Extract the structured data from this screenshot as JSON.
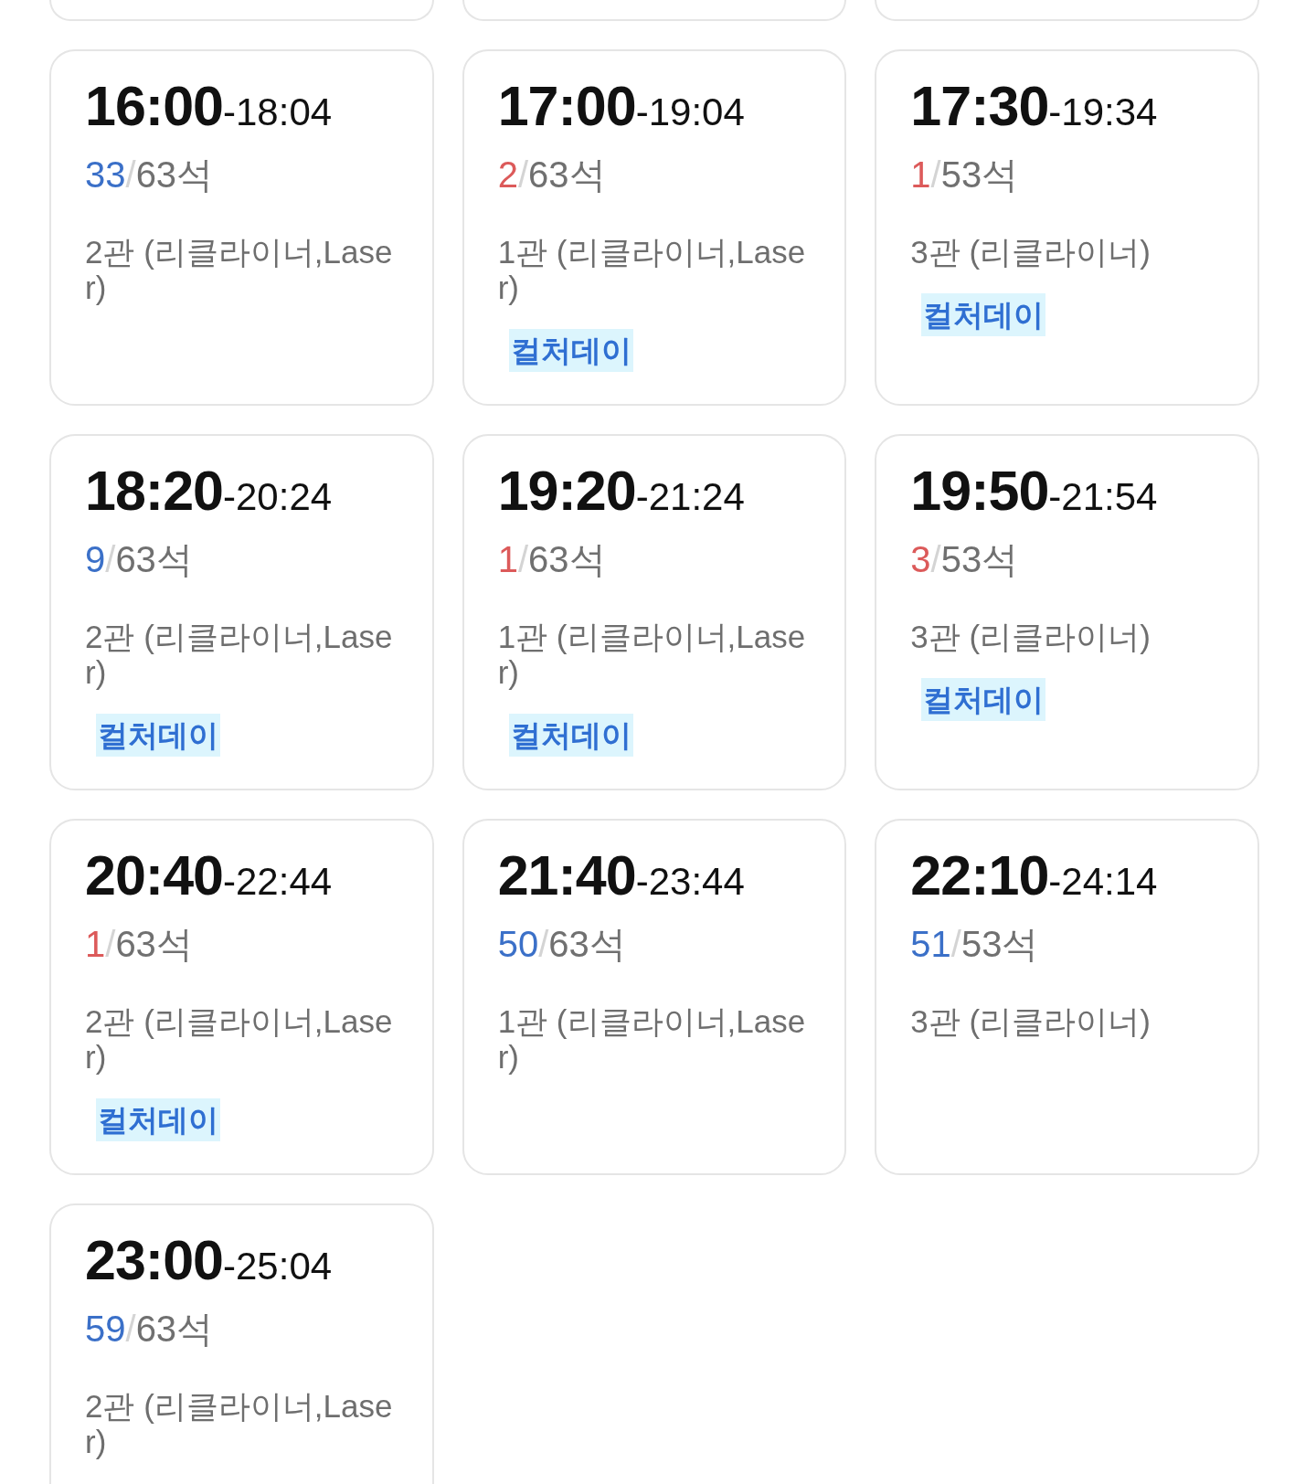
{
  "showtimes": [
    {
      "start": "16:00",
      "end": "-18:04",
      "seats": {
        "available": "33",
        "separator": "/",
        "total": "63석",
        "color": "#3b70c8"
      },
      "screen": "2관 (리클라이너,Laser)"
    },
    {
      "start": "17:00",
      "end": "-19:04",
      "seats": {
        "available": "2",
        "separator": "/",
        "total": "63석",
        "color": "#dc5a5a"
      },
      "screen": "1관 (리클라이너,Laser)",
      "badge": "컬처데이"
    },
    {
      "start": "17:30",
      "end": "-19:34",
      "seats": {
        "available": "1",
        "separator": "/",
        "total": "53석",
        "color": "#dc5a5a"
      },
      "screen": "3관 (리클라이너)",
      "badge": "컬처데이"
    },
    {
      "start": "18:20",
      "end": "-20:24",
      "seats": {
        "available": "9",
        "separator": "/",
        "total": "63석",
        "color": "#3b70c8"
      },
      "screen": "2관 (리클라이너,Laser)",
      "badge": "컬처데이"
    },
    {
      "start": "19:20",
      "end": "-21:24",
      "seats": {
        "available": "1",
        "separator": "/",
        "total": "63석",
        "color": "#dc5a5a"
      },
      "screen": "1관 (리클라이너,Laser)",
      "badge": "컬처데이"
    },
    {
      "start": "19:50",
      "end": "-21:54",
      "seats": {
        "available": "3",
        "separator": "/",
        "total": "53석",
        "color": "#dc5a5a"
      },
      "screen": "3관 (리클라이너)",
      "badge": "컬처데이"
    },
    {
      "start": "20:40",
      "end": "-22:44",
      "seats": {
        "available": "1",
        "separator": "/",
        "total": "63석",
        "color": "#dc5a5a"
      },
      "screen": "2관 (리클라이너,Laser)",
      "badge": "컬처데이"
    },
    {
      "start": "21:40",
      "end": "-23:44",
      "seats": {
        "available": "50",
        "separator": "/",
        "total": "63석",
        "color": "#3b70c8"
      },
      "screen": "1관 (리클라이너,Laser)"
    },
    {
      "start": "22:10",
      "end": "-24:14",
      "seats": {
        "available": "51",
        "separator": "/",
        "total": "53석",
        "color": "#3b70c8"
      },
      "screen": "3관 (리클라이너)"
    },
    {
      "start": "23:00",
      "end": "-25:04",
      "seats": {
        "available": "59",
        "separator": "/",
        "total": "63석",
        "color": "#3b70c8"
      },
      "screen": "2관 (리클라이너,Laser)"
    }
  ]
}
